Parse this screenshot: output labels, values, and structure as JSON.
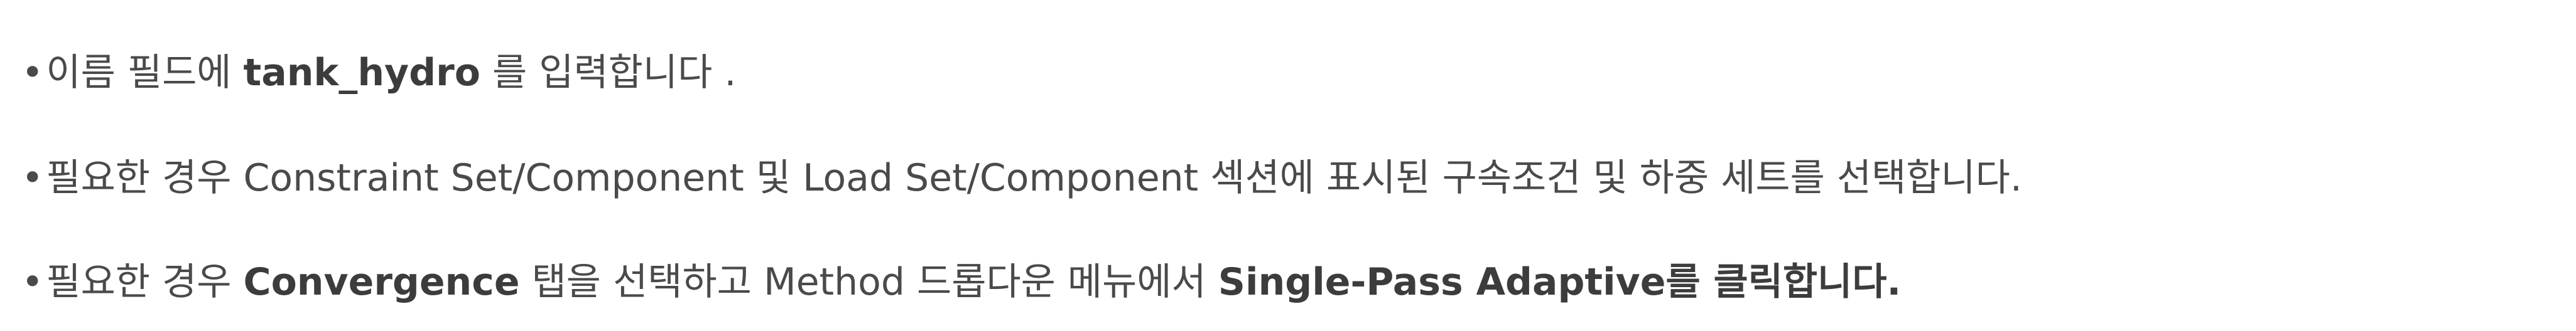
{
  "instructions": [
    {
      "bullet": "•",
      "parts": [
        {
          "text": "이름 필드에 ",
          "bold": false
        },
        {
          "text": "tank_hydro",
          "bold": true
        },
        {
          "text": " 를 입력합니다 .",
          "bold": false
        }
      ]
    },
    {
      "bullet": "•",
      "parts": [
        {
          "text": "필요한 경우 Constraint Set/Component 및 Load Set/Component 섹션에 표시된 구속조건 및 하중 세트를 선택합니다.",
          "bold": false
        }
      ]
    },
    {
      "bullet": "•",
      "parts": [
        {
          "text": "필요한 경우 ",
          "bold": false
        },
        {
          "text": "Convergence",
          "bold": true
        },
        {
          "text": " 탭을 선택하고 Method 드롭다운 메뉴에서 ",
          "bold": false
        },
        {
          "text": "Single-Pass Adaptive를 클릭합니다.",
          "bold": true
        }
      ]
    }
  ]
}
